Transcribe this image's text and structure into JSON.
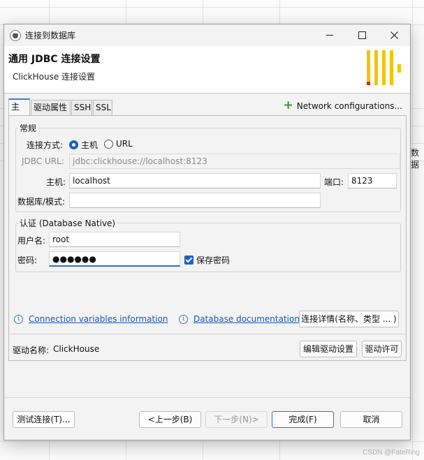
{
  "window": {
    "title": "连接到数据库"
  },
  "header": {
    "title": "通用 JDBC 连接设置",
    "subtitle": "ClickHouse 连接设置"
  },
  "colors": {
    "accent": "#1e60c9",
    "logo_yellow": "#f5c400",
    "logo_red": "#e0271e",
    "link": "#1d56b8",
    "plus": "#2e9a35"
  },
  "tabs": [
    {
      "label": "主要",
      "active": true
    },
    {
      "label": "驱动属性"
    },
    {
      "label": "SSH"
    },
    {
      "label": "SSL"
    }
  ],
  "network_config": {
    "icon": "plus-icon",
    "label": "Network configurations..."
  },
  "general": {
    "title": "常规",
    "connect_by_label": "连接方式:",
    "option_host": "主机",
    "option_url": "URL",
    "selected": "主机",
    "jdbc_url_label": "JDBC URL:",
    "jdbc_url_value": "jdbc:clickhouse://localhost:8123",
    "host_label": "主机:",
    "host_value": "localhost",
    "port_label": "端口:",
    "port_value": "8123",
    "database_label": "数据库/模式:",
    "database_value": ""
  },
  "auth": {
    "title": "认证 (Database Native)",
    "username_label": "用户名:",
    "username_value": "root",
    "password_label": "密码:",
    "password_value": "●●●●●●",
    "save_password_label": "保存密码",
    "save_password_checked": true
  },
  "links": {
    "conn_vars": "Connection variables information",
    "db_docs": "Database documentation",
    "conn_details_button": "连接详情(名称、类型 ... )"
  },
  "driver": {
    "name_label": "驱动名称:",
    "name_value": "ClickHouse",
    "edit_button": "编辑驱动设置",
    "license_button": "驱动许可"
  },
  "footer": {
    "test_button": "测试连接(T)...",
    "back_button": "<上一步(B)",
    "next_button": "下一步(N)>",
    "finish_button": "完成(F)",
    "cancel_button": "取消"
  },
  "background": {
    "cell_text": "数据"
  },
  "watermark": "CSDN @FateRing"
}
